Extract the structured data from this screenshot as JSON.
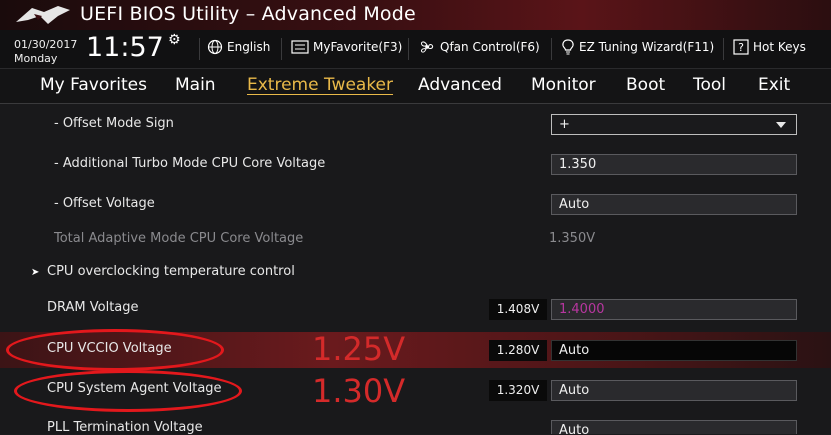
{
  "window": {
    "title": "UEFI BIOS Utility – Advanced Mode"
  },
  "status": {
    "date": "01/30/2017",
    "day": "Monday",
    "time": "11:57"
  },
  "toolbar": {
    "language": "English",
    "myfavorite": "MyFavorite(F3)",
    "qfan": "Qfan Control(F6)",
    "ez_tuning": "EZ Tuning Wizard(F11)",
    "hot_keys": "Hot Keys"
  },
  "menu": {
    "items": [
      "My Favorites",
      "Main",
      "Extreme Tweaker",
      "Advanced",
      "Monitor",
      "Boot",
      "Tool",
      "Exit"
    ],
    "active": "Extreme Tweaker"
  },
  "settings": {
    "offset_mode_sign": {
      "label": "- Offset Mode Sign",
      "value": "+"
    },
    "additional_turbo": {
      "label": "- Additional Turbo Mode CPU Core Voltage",
      "value": "1.350"
    },
    "offset_voltage": {
      "label": "- Offset Voltage",
      "value": "Auto"
    },
    "total_adaptive": {
      "label": "Total Adaptive Mode CPU Core Voltage",
      "value": "1.350V"
    },
    "cpu_oc_temp": {
      "label": "CPU overclocking temperature control"
    },
    "dram_voltage": {
      "label": "DRAM Voltage",
      "reading": "1.408V",
      "value": "1.4000"
    },
    "cpu_vccio": {
      "label": "CPU VCCIO Voltage",
      "reading": "1.280V",
      "value": "Auto"
    },
    "cpu_sa": {
      "label": "CPU System Agent Voltage",
      "reading": "1.320V",
      "value": "Auto"
    },
    "pll_termination": {
      "label": "PLL Termination Voltage",
      "value": "Auto"
    }
  },
  "annotations": {
    "vccio_note": "1.25V",
    "sa_note": "1.30V",
    "color": "#d42a2a"
  },
  "colors": {
    "accent": "#e9b949",
    "highlight": "#6a1a1d",
    "dram_value": "#b836a0"
  }
}
